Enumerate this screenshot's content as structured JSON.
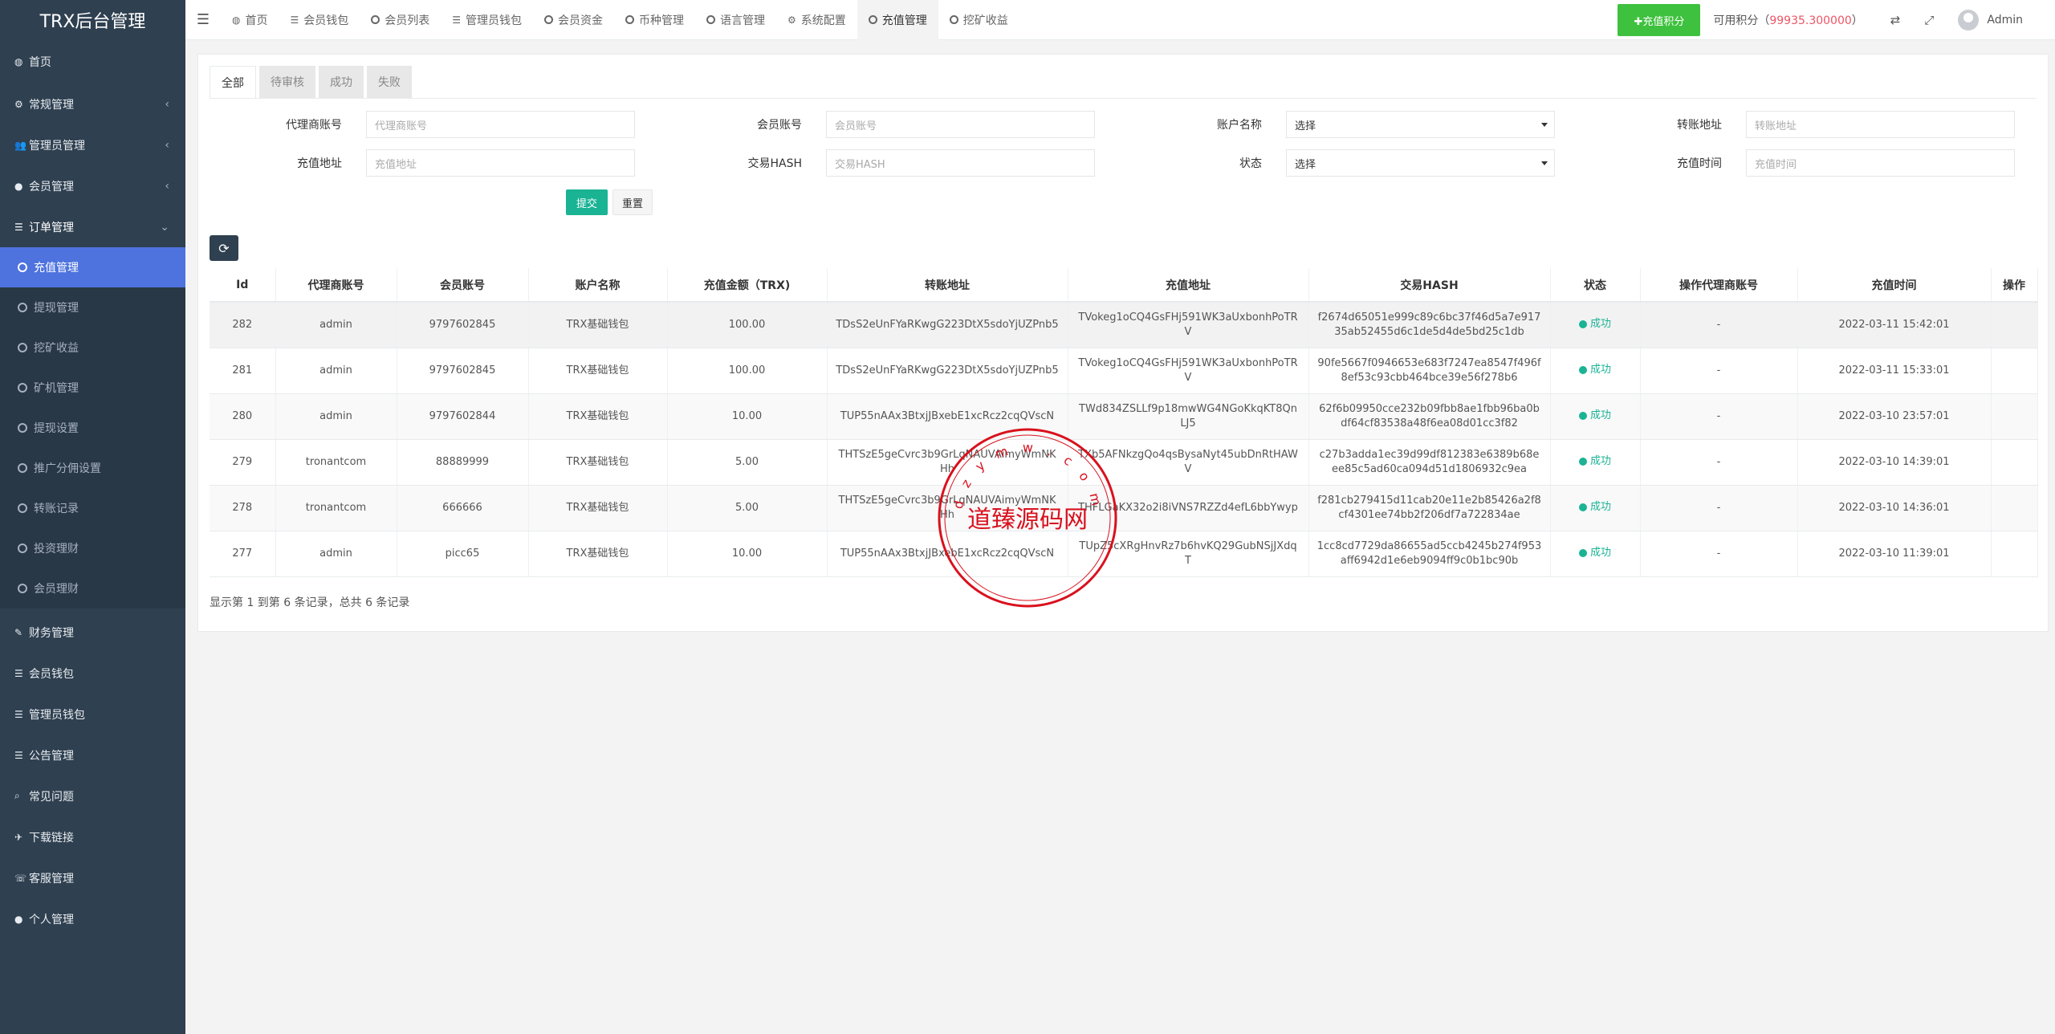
{
  "brand": "TRX后台管理",
  "sidebar": {
    "items": [
      {
        "label": "首页",
        "icon": "dashboard-icon"
      },
      {
        "label": "常规管理",
        "icon": "cogs-icon",
        "caret": "‹"
      },
      {
        "label": "管理员管理",
        "icon": "users-icon",
        "caret": "‹"
      },
      {
        "label": "会员管理",
        "icon": "user-icon",
        "caret": "‹"
      },
      {
        "label": "订单管理",
        "icon": "list-icon",
        "caret": "⌄"
      }
    ],
    "sub_items": [
      {
        "label": "充值管理"
      },
      {
        "label": "提现管理"
      },
      {
        "label": "挖矿收益"
      },
      {
        "label": "矿机管理"
      },
      {
        "label": "提现设置"
      },
      {
        "label": "推广分佣设置"
      },
      {
        "label": "转账记录"
      },
      {
        "label": "投资理财"
      },
      {
        "label": "会员理财"
      }
    ],
    "bottom_items": [
      {
        "label": "财务管理",
        "icon": "edit-icon"
      },
      {
        "label": "会员钱包",
        "icon": "list-icon"
      },
      {
        "label": "管理员钱包",
        "icon": "list-icon"
      },
      {
        "label": "公告管理",
        "icon": "list-icon"
      },
      {
        "label": "常见问题",
        "icon": "search-icon"
      },
      {
        "label": "下载链接",
        "icon": "plane-icon"
      },
      {
        "label": "客服管理",
        "icon": "support-icon"
      },
      {
        "label": "个人管理",
        "icon": "user-icon"
      }
    ]
  },
  "topbar": {
    "tabs": [
      {
        "label": "首页",
        "icon": "dashboard-icon"
      },
      {
        "label": "会员钱包",
        "icon": "list-icon"
      },
      {
        "label": "会员列表",
        "icon": "circle-icon"
      },
      {
        "label": "管理员钱包",
        "icon": "list-icon"
      },
      {
        "label": "会员资金",
        "icon": "circle-icon"
      },
      {
        "label": "币种管理",
        "icon": "circle-icon"
      },
      {
        "label": "语言管理",
        "icon": "circle-icon"
      },
      {
        "label": "系统配置",
        "icon": "gear-icon"
      },
      {
        "label": "充值管理",
        "icon": "circle-icon"
      },
      {
        "label": "挖矿收益",
        "icon": "circle-icon"
      }
    ],
    "recharge_button": "✚充值积分",
    "points_label": "可用积分（",
    "points_value": "99935.300000",
    "points_suffix": "）",
    "admin_name": "Admin"
  },
  "filters": {
    "tabs": [
      "全部",
      "待审核",
      "成功",
      "失败"
    ],
    "row1": [
      {
        "label": "代理商账号",
        "placeholder": "代理商账号"
      },
      {
        "label": "会员账号",
        "placeholder": "会员账号"
      },
      {
        "label": "账户名称",
        "placeholder": "选择"
      },
      {
        "label": "转账地址",
        "placeholder": "转账地址"
      }
    ],
    "row2": [
      {
        "label": "充值地址",
        "placeholder": "充值地址"
      },
      {
        "label": "交易HASH",
        "placeholder": "交易HASH"
      },
      {
        "label": "状态",
        "placeholder": "选择"
      },
      {
        "label": "充值时间",
        "placeholder": "充值时间"
      }
    ],
    "submit": "提交",
    "reset": "重置"
  },
  "table": {
    "headers": [
      "Id",
      "代理商账号",
      "会员账号",
      "账户名称",
      "充值金额（TRX)",
      "转账地址",
      "充值地址",
      "交易HASH",
      "状态",
      "操作代理商账号",
      "充值时间",
      "操作"
    ],
    "rows": [
      [
        "282",
        "admin",
        "9797602845",
        "TRX基础钱包",
        "100.00",
        "TDsS2eUnFYaRKwgG223DtX5sdoYjUZPnb5",
        "TVokeg1oCQ4GsFHj591WK3aUxbonhPoTRV",
        "f2674d65051e999c89c6bc37f46d5a7e91735ab52455d6c1de5d4de5bd25c1db",
        "成功",
        "-",
        "2022-03-11 15:42:01",
        ""
      ],
      [
        "281",
        "admin",
        "9797602845",
        "TRX基础钱包",
        "100.00",
        "TDsS2eUnFYaRKwgG223DtX5sdoYjUZPnb5",
        "TVokeg1oCQ4GsFHj591WK3aUxbonhPoTRV",
        "90fe5667f0946653e683f7247ea8547f496f8ef53c93cbb464bce39e56f278b6",
        "成功",
        "-",
        "2022-03-11 15:33:01",
        ""
      ],
      [
        "280",
        "admin",
        "9797602844",
        "TRX基础钱包",
        "10.00",
        "TUP55nAAx3BtxjJBxebE1xcRcz2cqQVscN",
        "TWd834ZSLLf9p18mwWG4NGoKkqKT8QnLJ5",
        "62f6b09950cce232b09fbb8ae1fbb96ba0bdf64cf83538a48f6ea08d01cc3f82",
        "成功",
        "-",
        "2022-03-10 23:57:01",
        ""
      ],
      [
        "279",
        "tronantcom",
        "88889999",
        "TRX基础钱包",
        "5.00",
        "THTSzE5geCvrc3b9GrLqNAUVAimyWmNKHh",
        "TXb5AFNkzgQo4qsBysaNyt45ubDnRtHAWV",
        "c27b3adda1ec39d99df812383e6389b68eee85c5ad60ca094d51d1806932c9ea",
        "成功",
        "-",
        "2022-03-10 14:39:01",
        ""
      ],
      [
        "278",
        "tronantcom",
        "666666",
        "TRX基础钱包",
        "5.00",
        "THTSzE5geCvrc3b9GrLqNAUVAimyWmNKHh",
        "THFLGaKX32o2i8iVNS7RZZd4efL6bbYwyp",
        "f281cb279415d11cab20e11e2b85426a2f8cf4301ee74bb2f206df7a722834ae",
        "成功",
        "-",
        "2022-03-10 14:36:01",
        ""
      ],
      [
        "277",
        "admin",
        "picc65",
        "TRX基础钱包",
        "10.00",
        "TUP55nAAx3BtxjJBxebE1xcRcz2cqQVscN",
        "TUpZ5cXRgHnvRz7b6hvKQ29GubNSjJXdqT",
        "1cc8cd7729da86655ad5ccb4245b274f953aff6942d1e6eb9094ff9c0b1bc90b",
        "成功",
        "-",
        "2022-03-10 11:39:01",
        ""
      ]
    ]
  },
  "summary": "显示第 1 到第 6 条记录，总共 6 条记录",
  "watermark": {
    "text": "道臻源码网",
    "ring_text": "d z y m w . c o m",
    "color": "#d9111d"
  }
}
